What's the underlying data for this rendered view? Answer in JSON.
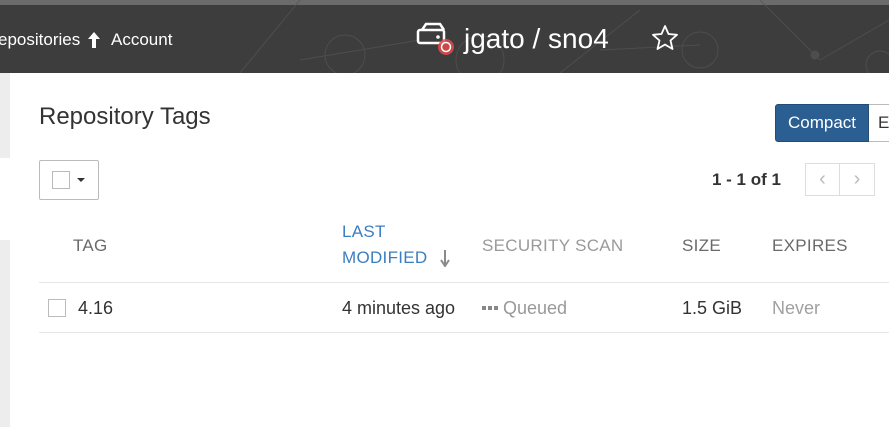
{
  "header": {
    "nav": {
      "repositories_label": "epositories",
      "account_label": "Account"
    },
    "repo_title": "jgato / sno4",
    "icons": {
      "repo": "hard-drive-icon",
      "upload": "upload-arrow-icon",
      "star": "star-outline-icon"
    }
  },
  "page": {
    "title": "Repository Tags",
    "view_toggle": {
      "compact_label": "Compact",
      "expanded_label": "E"
    },
    "pagination": {
      "text": "1 - 1 of 1",
      "prev": "‹",
      "next": "›"
    }
  },
  "table": {
    "headers": {
      "tag": "TAG",
      "last_modified": "LAST",
      "last_modified_2": "MODIFIED",
      "security_scan": "SECURITY SCAN",
      "size": "SIZE",
      "expires": "EXPIRES"
    },
    "sort": {
      "column": "last_modified",
      "direction": "descending"
    },
    "rows": [
      {
        "tag": "4.16",
        "last_modified": "4 minutes ago",
        "security_scan": "Queued",
        "size": "1.5 GiB",
        "expires": "Never"
      }
    ]
  },
  "colors": {
    "header_bg": "#3d3d3d",
    "primary_button": "#2b5e91",
    "link": "#3b7ec0"
  }
}
